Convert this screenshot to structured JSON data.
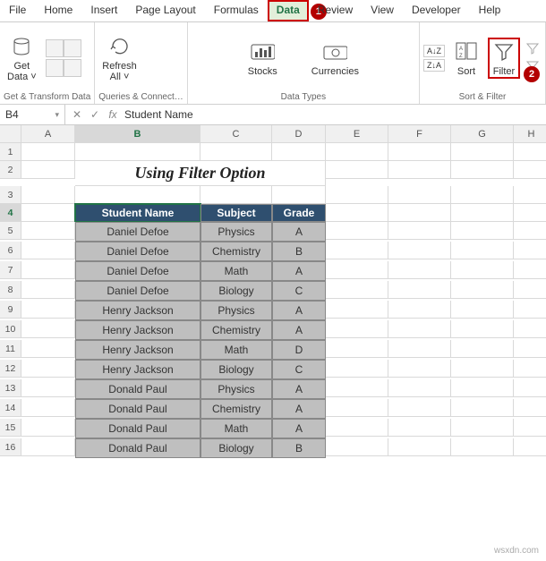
{
  "menu": {
    "items": [
      "File",
      "Home",
      "Insert",
      "Page Layout",
      "Formulas",
      "Data",
      "Review",
      "View",
      "Developer",
      "Help"
    ],
    "active_index": 5,
    "badge1": "1"
  },
  "ribbon": {
    "groups": [
      {
        "label": "Get & Transform Data",
        "buttons": [
          {
            "label": "Get\nData ˅"
          }
        ]
      },
      {
        "label": "Queries & Connect…",
        "buttons": [
          {
            "label": "Refresh\nAll ˅"
          }
        ]
      },
      {
        "label": "Data Types",
        "buttons": [
          {
            "label": "Stocks"
          },
          {
            "label": "Currencies"
          }
        ]
      },
      {
        "label": "Sort & Filter",
        "buttons": [
          {
            "label": "A→Z"
          },
          {
            "label": "Z→A"
          },
          {
            "label": "Sort"
          },
          {
            "label": "Filter",
            "highlight": true,
            "badge": "2"
          }
        ]
      }
    ]
  },
  "formula_bar": {
    "name_box": "B4",
    "fx_label": "fx",
    "content": "Student Name"
  },
  "columns": [
    "A",
    "B",
    "C",
    "D",
    "E",
    "F",
    "G",
    "H"
  ],
  "active_col_index": 1,
  "active_row": 4,
  "worksheet": {
    "title": "Using Filter Option",
    "headers": [
      "Student Name",
      "Subject",
      "Grade"
    ],
    "rows": [
      [
        "Daniel Defoe",
        "Physics",
        "A"
      ],
      [
        "Daniel Defoe",
        "Chemistry",
        "B"
      ],
      [
        "Daniel Defoe",
        "Math",
        "A"
      ],
      [
        "Daniel Defoe",
        "Biology",
        "C"
      ],
      [
        "Henry Jackson",
        "Physics",
        "A"
      ],
      [
        "Henry Jackson",
        "Chemistry",
        "A"
      ],
      [
        "Henry Jackson",
        "Math",
        "D"
      ],
      [
        "Henry Jackson",
        "Biology",
        "C"
      ],
      [
        "Donald Paul",
        "Physics",
        "A"
      ],
      [
        "Donald Paul",
        "Chemistry",
        "A"
      ],
      [
        "Donald Paul",
        "Math",
        "A"
      ],
      [
        "Donald Paul",
        "Biology",
        "B"
      ]
    ]
  },
  "watermark": "wsxdn.com"
}
